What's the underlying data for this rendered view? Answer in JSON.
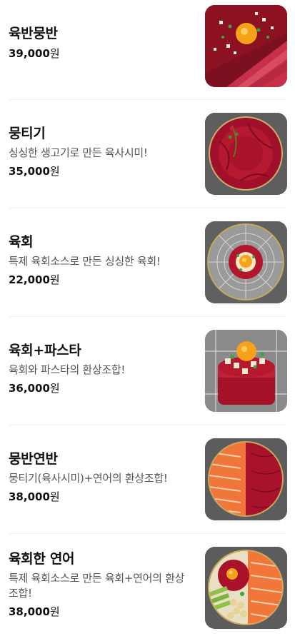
{
  "menu": {
    "items": [
      {
        "name": "육반뭉반",
        "desc": "",
        "price": "39,000",
        "currency": "원",
        "thumb_icon": "yukbanmungban-photo"
      },
      {
        "name": "뭉티기",
        "desc": "싱싱한 생고기로 만든 육사시미!",
        "price": "35,000",
        "currency": "원",
        "thumb_icon": "mungtigi-photo"
      },
      {
        "name": "육회",
        "desc": "특제 육회소스로 만든 싱싱한 육회!",
        "price": "22,000",
        "currency": "원",
        "thumb_icon": "yukhoe-photo"
      },
      {
        "name": "육회+파스타",
        "desc": "육회와 파스타의 환상조합!",
        "price": "36,000",
        "currency": "원",
        "thumb_icon": "yukhoe-pasta-photo"
      },
      {
        "name": "뭉반연반",
        "desc": "뭉티기(육사시미)+연어의 환상조합!",
        "price": "38,000",
        "currency": "원",
        "thumb_icon": "mungbanyeonban-photo"
      },
      {
        "name": "육회한 연어",
        "desc": "특제 육회소스로 만든 육회+연어의 환상조합!",
        "price": "38,000",
        "currency": "원",
        "thumb_icon": "yukhoe-salmon-photo"
      }
    ]
  },
  "colors": {
    "text_primary": "#111111",
    "text_secondary": "#555555",
    "divider": "#eeeeee",
    "raw_beef": "#b3142a",
    "salmon": "#f2753a",
    "egg_yolk": "#f5a21a"
  }
}
